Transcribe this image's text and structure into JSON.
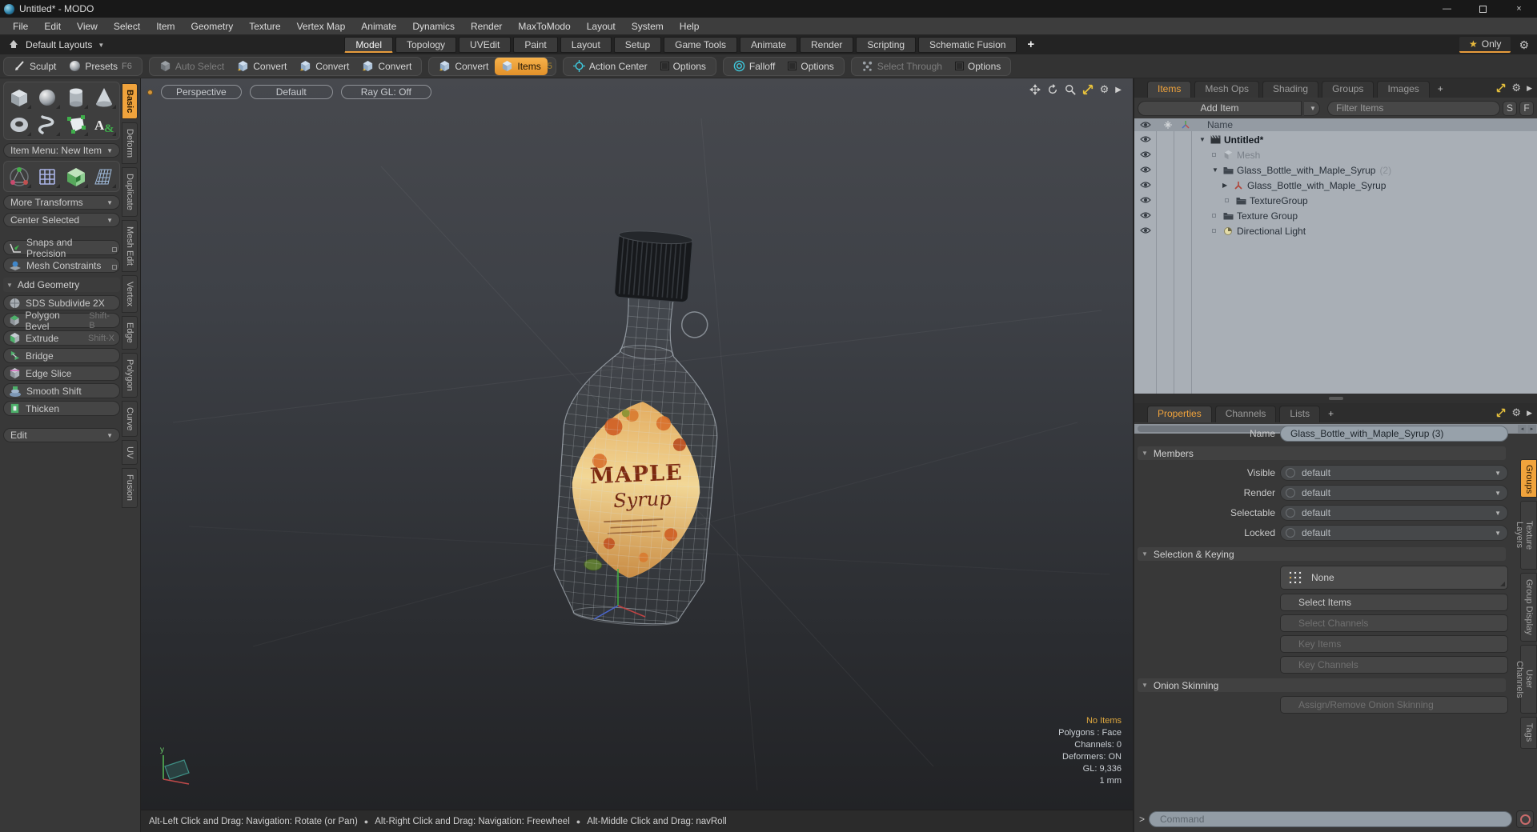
{
  "colors": {
    "accent": "#f0a33c",
    "status_highlight": "#e0a93f",
    "falloff_cyan": "#3ec6da"
  },
  "window": {
    "title": "Untitled* - MODO",
    "minimize": "—",
    "close": "×"
  },
  "menu": {
    "items": [
      "File",
      "Edit",
      "View",
      "Select",
      "Item",
      "Geometry",
      "Texture",
      "Vertex Map",
      "Animate",
      "Dynamics",
      "Render",
      "MaxToModo",
      "Layout",
      "System",
      "Help"
    ]
  },
  "layout_bar": {
    "layouts_label": "Default Layouts",
    "tabs": [
      "Model",
      "Topology",
      "UVEdit",
      "Paint",
      "Layout",
      "Setup",
      "Game Tools",
      "Animate",
      "Render",
      "Scripting",
      "Schematic Fusion"
    ],
    "active_tab": "Model",
    "add_tab": "+",
    "star": "★",
    "only_label": "Only"
  },
  "toolbar": {
    "buttons": [
      {
        "label": "Sculpt",
        "icon": "sculpt-brush-icon"
      },
      {
        "label": "Presets",
        "shortcut": "F6",
        "icon": "preset-sphere-icon"
      },
      {
        "label": "Auto Select",
        "icon": "cube-gray-icon",
        "disabled": true
      },
      {
        "label": "Convert",
        "icon": "cube-blue-icon"
      },
      {
        "label": "Convert",
        "icon": "cube-blue-icon"
      },
      {
        "label": "Convert",
        "icon": "cube-blue-icon"
      },
      {
        "label": "Convert",
        "icon": "cube-blue-icon"
      },
      {
        "label": "Items",
        "shortcut": "5",
        "icon": "cube-blue-icon",
        "active": true
      },
      {
        "label": "Action Center",
        "icon": "action-center-icon"
      },
      {
        "label": "Options",
        "icon": "checkbox-icon"
      },
      {
        "label": "Falloff",
        "icon": "falloff-icon"
      },
      {
        "label": "Options",
        "icon": "checkbox-icon"
      },
      {
        "label": "Select Through",
        "icon": "select-through-icon",
        "disabled": true
      },
      {
        "label": "Options",
        "icon": "checkbox-icon"
      }
    ]
  },
  "sidebar": {
    "item_menu": "Item Menu: New Item",
    "more_transforms": "More Transforms",
    "center_selected": "Center Selected",
    "snaps": "Snaps and Precision",
    "mesh_constraints": "Mesh Constraints",
    "add_geometry": "Add Geometry",
    "tools": [
      {
        "label": "SDS Subdivide 2X",
        "shortcut": ""
      },
      {
        "label": "Polygon Bevel",
        "shortcut": "Shift-B"
      },
      {
        "label": "Extrude",
        "shortcut": "Shift-X"
      },
      {
        "label": "Bridge",
        "shortcut": ""
      },
      {
        "label": "Edge Slice",
        "shortcut": ""
      },
      {
        "label": "Smooth Shift",
        "shortcut": ""
      },
      {
        "label": "Thicken",
        "shortcut": ""
      }
    ],
    "edit": "Edit",
    "tabs": [
      "Basic",
      "Deform",
      "Duplicate",
      "Mesh Edit",
      "Vertex",
      "Edge",
      "Polygon",
      "Curve",
      "UV",
      "Fusion"
    ],
    "active_tab": "Basic"
  },
  "viewport": {
    "header_buttons": [
      "Perspective",
      "Default",
      "Ray GL: Off"
    ],
    "status": {
      "no_items": "No Items",
      "lines": [
        "Polygons : Face",
        "Channels: 0",
        "Deformers: ON",
        "GL: 9,336",
        "1 mm"
      ]
    },
    "gizmo_axis": "y",
    "bottle_label": {
      "title": "MAPLE",
      "subtitle": "Syrup"
    }
  },
  "items_panel": {
    "tabs": [
      "Items",
      "Mesh Ops",
      "Shading",
      "Groups",
      "Images"
    ],
    "active_tab": "Items",
    "add_tab": "+",
    "add_item": "Add Item",
    "filter_placeholder": "Filter Items",
    "s_button": "S",
    "f_button": "F",
    "name_header": "Name",
    "rows": [
      {
        "label": "Untitled*",
        "suffix": "",
        "depth": 0,
        "state": "expanded",
        "icon": "scene-icon"
      },
      {
        "label": "Mesh",
        "suffix": "",
        "depth": 1,
        "state": "leaf",
        "icon": "mesh-icon",
        "grayed": true
      },
      {
        "label": "Glass_Bottle_with_Maple_Syrup",
        "suffix": "(2)",
        "depth": 1,
        "state": "expanded",
        "icon": "group-icon"
      },
      {
        "label": "Glass_Bottle_with_Maple_Syrup",
        "suffix": "",
        "depth": 2,
        "state": "collapsed",
        "icon": "locator-icon"
      },
      {
        "label": "TextureGroup",
        "suffix": "",
        "depth": 2,
        "state": "leaf",
        "icon": "group-icon"
      },
      {
        "label": "Texture Group",
        "suffix": "",
        "depth": 1,
        "state": "leaf",
        "icon": "group-icon"
      },
      {
        "label": "Directional Light",
        "suffix": "",
        "depth": 1,
        "state": "leaf",
        "icon": "light-icon"
      }
    ]
  },
  "properties_panel": {
    "tabs": [
      "Properties",
      "Channels",
      "Lists"
    ],
    "active_tab": "Properties",
    "add_tab": "+",
    "name_label": "Name",
    "name_value": "Glass_Bottle_with_Maple_Syrup (3)",
    "members_section": "Members",
    "member_rows": [
      {
        "label": "Visible",
        "value": "default"
      },
      {
        "label": "Render",
        "value": "default"
      },
      {
        "label": "Selectable",
        "value": "default"
      },
      {
        "label": "Locked",
        "value": "default"
      }
    ],
    "selection_section": "Selection & Keying",
    "none_button": "None",
    "buttons": [
      {
        "label": "Select Items",
        "disabled": false
      },
      {
        "label": "Select Channels",
        "disabled": true
      },
      {
        "label": "Key Items",
        "disabled": true
      },
      {
        "label": "Key Channels",
        "disabled": true
      }
    ],
    "onion_section": "Onion Skinning",
    "onion_button": "Assign/Remove Onion Skinning",
    "side_tabs": [
      "Groups",
      "Texture Layers",
      "Group Display",
      "User Channels",
      "Tags"
    ],
    "active_side_tab": "Groups"
  },
  "command_bar": {
    "prompt": ">",
    "placeholder": "Command"
  },
  "help_bar": {
    "separator": "●",
    "segments": [
      "Alt-Left Click and Drag: Navigation: Rotate (or Pan)",
      "Alt-Right Click and Drag: Navigation: Freewheel",
      "Alt-Middle Click and Drag: navRoll"
    ]
  }
}
